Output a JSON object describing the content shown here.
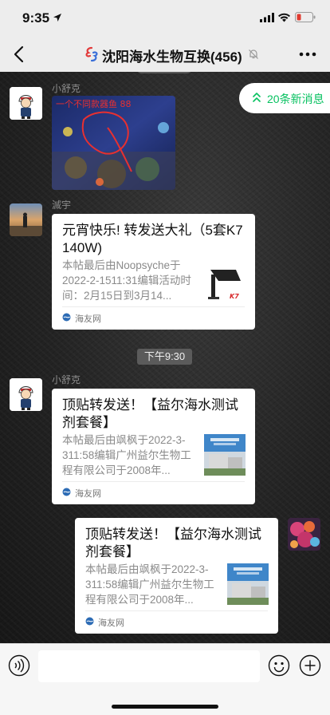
{
  "status_bar": {
    "time": "9:35"
  },
  "nav": {
    "title": "沈阳海水生物互换(456)"
  },
  "new_messages": {
    "label": "20条新消息"
  },
  "messages": [
    {
      "type": "image",
      "sender": "小舒克",
      "overlay_text": "一个不同款器鱼 88"
    },
    {
      "type": "link_card",
      "sender": "滅宇",
      "title": "元宵快乐! 转发送大礼（5套K7 140W)",
      "desc": "本帖最后由Noopsyche于2022-2-1511:31编辑活动时间：2月15日到3月14...",
      "thumb_logo": "K7",
      "source": "海友网"
    },
    {
      "type": "time",
      "text": "下午9:30"
    },
    {
      "type": "link_card",
      "sender": "小舒克",
      "title": "顶贴转发送！【益尔海水测试剂套餐】",
      "desc": "本帖最后由飒枫于2022-3-311:58编辑广州益尔生物工程有限公司于2008年...",
      "source": "海友网"
    },
    {
      "type": "link_card",
      "sender": "",
      "title": "顶贴转发送！【益尔海水测试剂套餐】",
      "desc": "本帖最后由飒枫于2022-3-311:58编辑广州益尔生物工程有限公司于2008年...",
      "source": "海友网"
    }
  ],
  "colors": {
    "accent": "#07c160",
    "bar_bg": "#ededed"
  }
}
